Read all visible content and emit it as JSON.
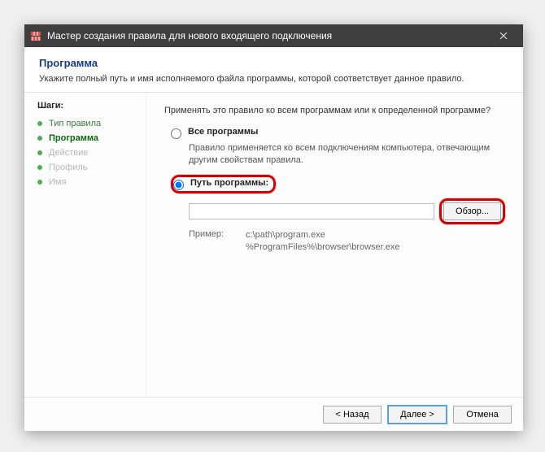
{
  "window": {
    "title": "Мастер создания правила для нового входящего подключения"
  },
  "header": {
    "title": "Программа",
    "subtitle": "Укажите полный путь и имя исполняемого файла программы, которой соответствует данное правило."
  },
  "sidebar": {
    "steps_label": "Шаги:",
    "items": [
      {
        "label": "Тип правила",
        "state": "done"
      },
      {
        "label": "Программа",
        "state": "active"
      },
      {
        "label": "Действие",
        "state": "faded"
      },
      {
        "label": "Профиль",
        "state": "faded"
      },
      {
        "label": "Имя",
        "state": "faded"
      }
    ]
  },
  "content": {
    "question": "Применять это правило ко всем программам или к определенной программе?",
    "opt_all": {
      "label": "Все программы",
      "desc": "Правило применяется ко всем подключениям компьютера, отвечающим другим свойствам правила."
    },
    "opt_path": {
      "label": "Путь программы:",
      "input_value": "",
      "browse_label": "Обзор..."
    },
    "example": {
      "label": "Пример:",
      "line1": "c:\\path\\program.exe",
      "line2": "%ProgramFiles%\\browser\\browser.exe"
    }
  },
  "footer": {
    "back": "< Назад",
    "next": "Далее >",
    "cancel": "Отмена"
  }
}
